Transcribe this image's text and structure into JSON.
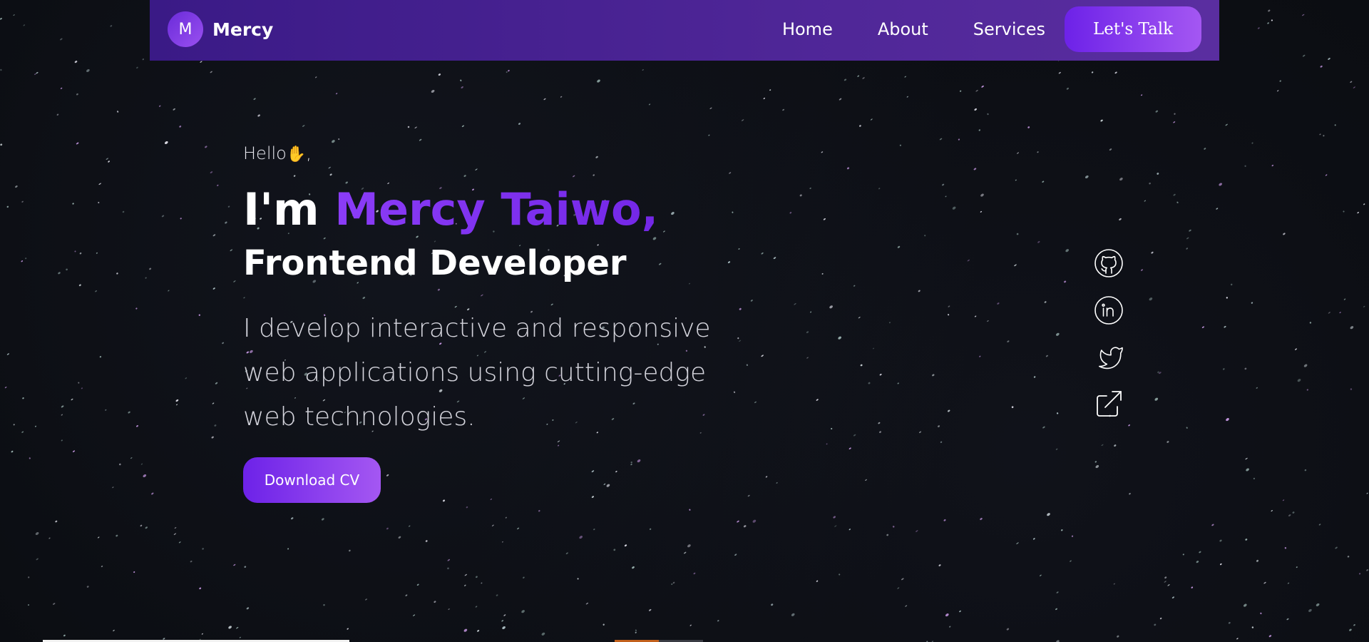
{
  "navbar": {
    "brand_initial": "M",
    "brand_name": "Mercy",
    "links": [
      "Home",
      "About",
      "Services"
    ],
    "cta_label": "Let's Talk"
  },
  "hero": {
    "greeting": "Hello",
    "greeting_emoji": "✋",
    "greeting_suffix": ",",
    "headline_prefix": "I'm ",
    "name": "Mercy Taiwo,",
    "role": "Frontend Developer",
    "description": "I develop interactive and responsive web applications using cutting-edge web technologies.",
    "download_label": "Download CV"
  },
  "socials": [
    {
      "icon": "github-icon"
    },
    {
      "icon": "linkedin-icon"
    },
    {
      "icon": "twitter-icon"
    },
    {
      "icon": "external-link-icon"
    }
  ],
  "colors": {
    "navbar": "#4d2596",
    "accent": "#7327e6",
    "accent_light": "#a457f2",
    "background": "#0b0d12"
  }
}
